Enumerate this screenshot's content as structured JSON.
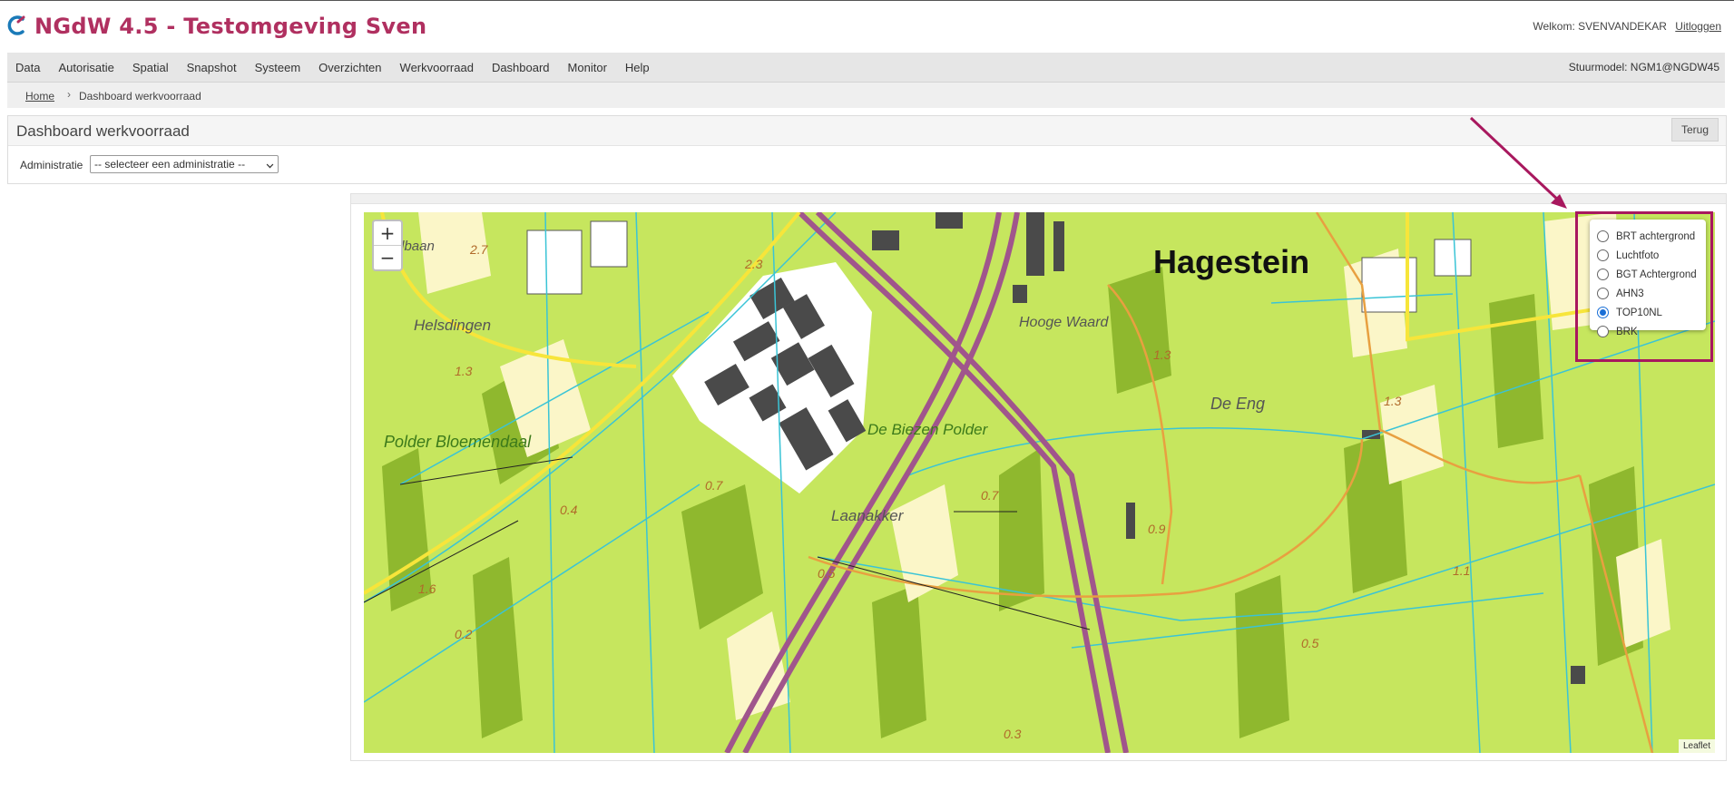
{
  "header": {
    "title": "NGdW 4.5 - Testomgeving Sven",
    "welcome_text": "Welkom: SVENVANDEKAR",
    "logout_label": "Uitloggen"
  },
  "menu": {
    "items": [
      "Data",
      "Autorisatie",
      "Spatial",
      "Snapshot",
      "Systeem",
      "Overzichten",
      "Werkvoorraad",
      "Dashboard",
      "Monitor",
      "Help"
    ],
    "control_model": "Stuurmodel: NGM1@NGDW45"
  },
  "breadcrumb": {
    "home": "Home",
    "separator": "›",
    "current": "Dashboard werkvoorraad"
  },
  "panel": {
    "title": "Dashboard werkvoorraad",
    "back_label": "Terug",
    "admin_label": "Administratie",
    "admin_select_value": "-- selecteer een administratie --"
  },
  "map": {
    "zoom_in": "+",
    "zoom_out": "−",
    "attribution": "Leaflet",
    "layers": [
      {
        "label": "BRT achtergrond",
        "selected": false
      },
      {
        "label": "Luchtfoto",
        "selected": false
      },
      {
        "label": "BGT Achtergrond",
        "selected": false
      },
      {
        "label": "AHN3",
        "selected": false
      },
      {
        "label": "TOP10NL",
        "selected": true
      },
      {
        "label": "BRK",
        "selected": false
      }
    ],
    "place_labels": [
      "Hagestein",
      "Helsdingen",
      "Hooge Waard",
      "De Eng",
      "Polder Bloemendaal",
      "De Biezen Polder",
      "Laanakker",
      "Vollbaan"
    ],
    "height_labels": [
      "2.7",
      "2.3",
      "1.3",
      "1.3",
      "1.3",
      "0.7",
      "0.7",
      "0.4",
      "0.9",
      "0.5",
      "0.5",
      "1.1",
      "0.2",
      "1.6",
      "0.3"
    ],
    "highlight_color": "#a8185e",
    "title_color": "#b03060"
  }
}
